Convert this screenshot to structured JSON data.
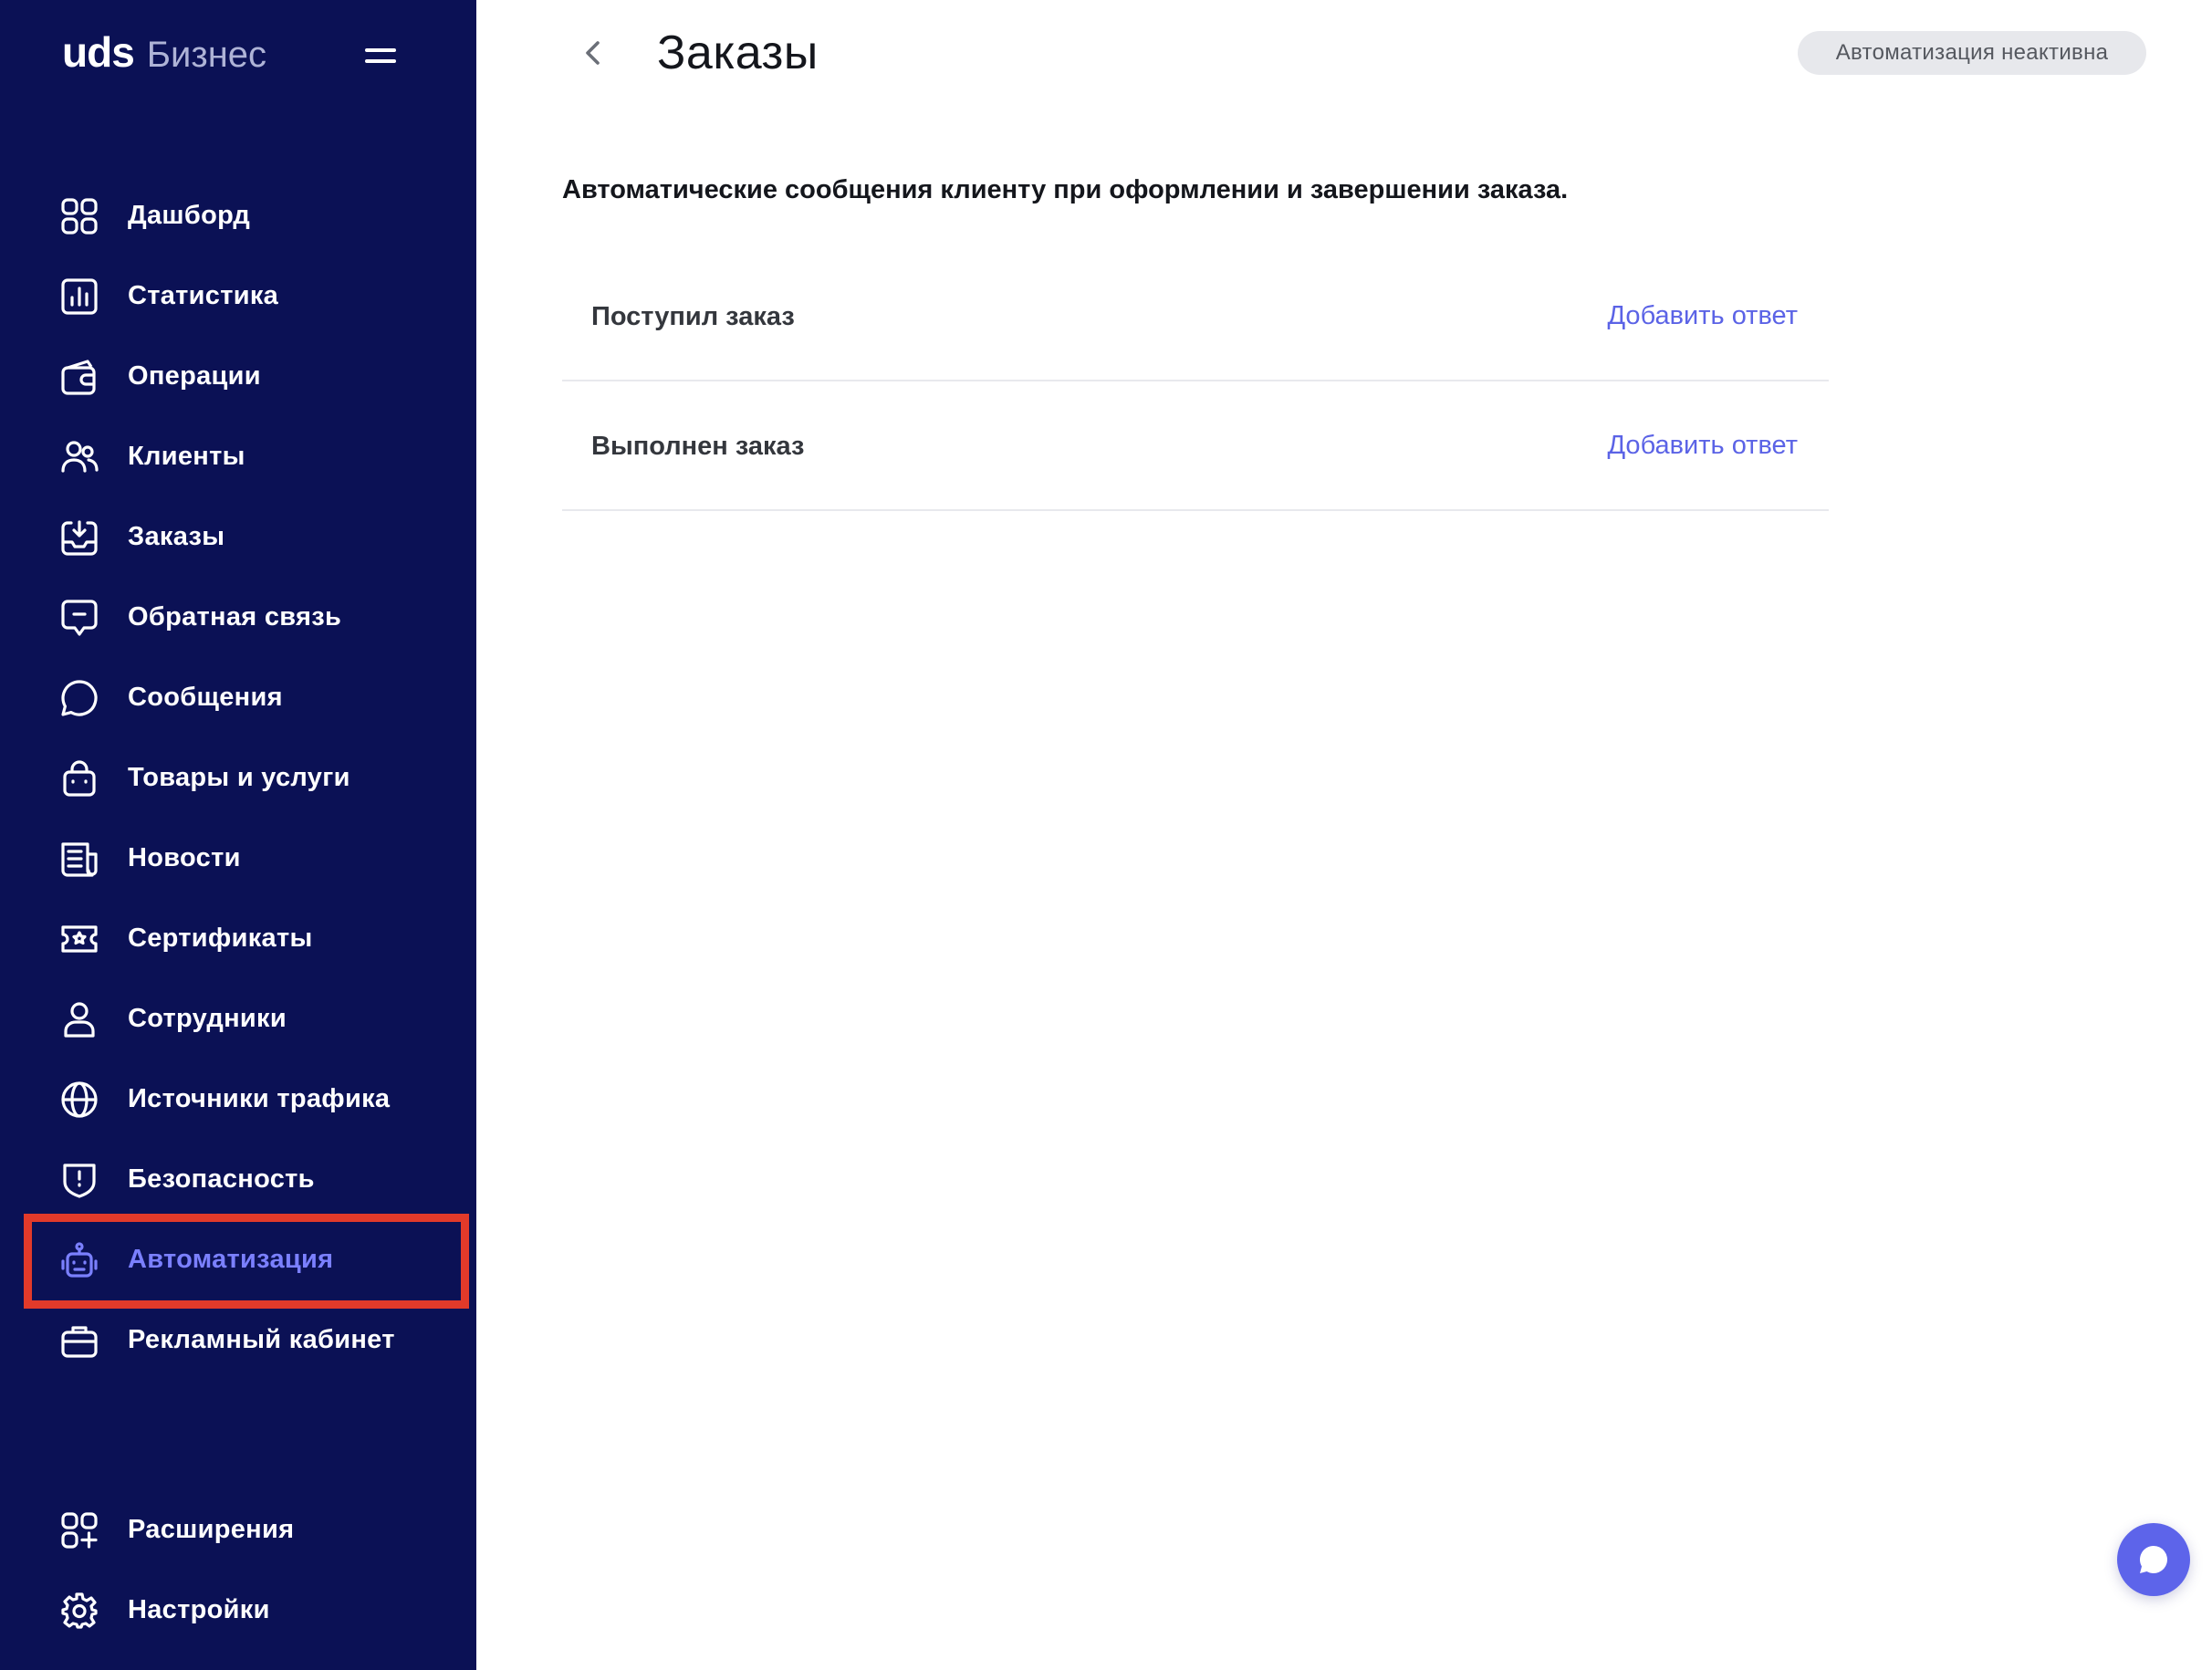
{
  "brand": {
    "logo_main": "uds",
    "logo_sub": "Бизнес"
  },
  "sidebar": {
    "items": [
      {
        "label": "Дашборд",
        "icon": "dashboard-icon"
      },
      {
        "label": "Статистика",
        "icon": "statistics-icon"
      },
      {
        "label": "Операции",
        "icon": "operations-icon"
      },
      {
        "label": "Клиенты",
        "icon": "clients-icon"
      },
      {
        "label": "Заказы",
        "icon": "orders-icon"
      },
      {
        "label": "Обратная связь",
        "icon": "feedback-icon"
      },
      {
        "label": "Сообщения",
        "icon": "messages-icon"
      },
      {
        "label": "Товары и услуги",
        "icon": "goods-icon"
      },
      {
        "label": "Новости",
        "icon": "news-icon"
      },
      {
        "label": "Сертификаты",
        "icon": "certificates-icon"
      },
      {
        "label": "Сотрудники",
        "icon": "employees-icon"
      },
      {
        "label": "Источники трафика",
        "icon": "traffic-sources-icon"
      },
      {
        "label": "Безопасность",
        "icon": "security-icon"
      },
      {
        "label": "Автоматизация",
        "icon": "automation-icon",
        "active": true
      },
      {
        "label": "Рекламный кабинет",
        "icon": "ad-cabinet-icon"
      }
    ],
    "bottom_items": [
      {
        "label": "Расширения",
        "icon": "extensions-icon"
      },
      {
        "label": "Настройки",
        "icon": "settings-icon"
      }
    ]
  },
  "header": {
    "title": "Заказы",
    "status_badge": "Автоматизация неактивна"
  },
  "main": {
    "description": "Автоматические сообщения клиенту при оформлении и завершении заказа.",
    "rows": [
      {
        "title": "Поступил заказ",
        "action": "Добавить ответ"
      },
      {
        "title": "Выполнен заказ",
        "action": "Добавить ответ"
      }
    ]
  },
  "colors": {
    "sidebar_bg": "#0b1155",
    "accent": "#5b63e6",
    "active_item": "#7b80ff",
    "highlight_frame": "#e23a2a",
    "badge_bg": "#e7e8ec"
  }
}
